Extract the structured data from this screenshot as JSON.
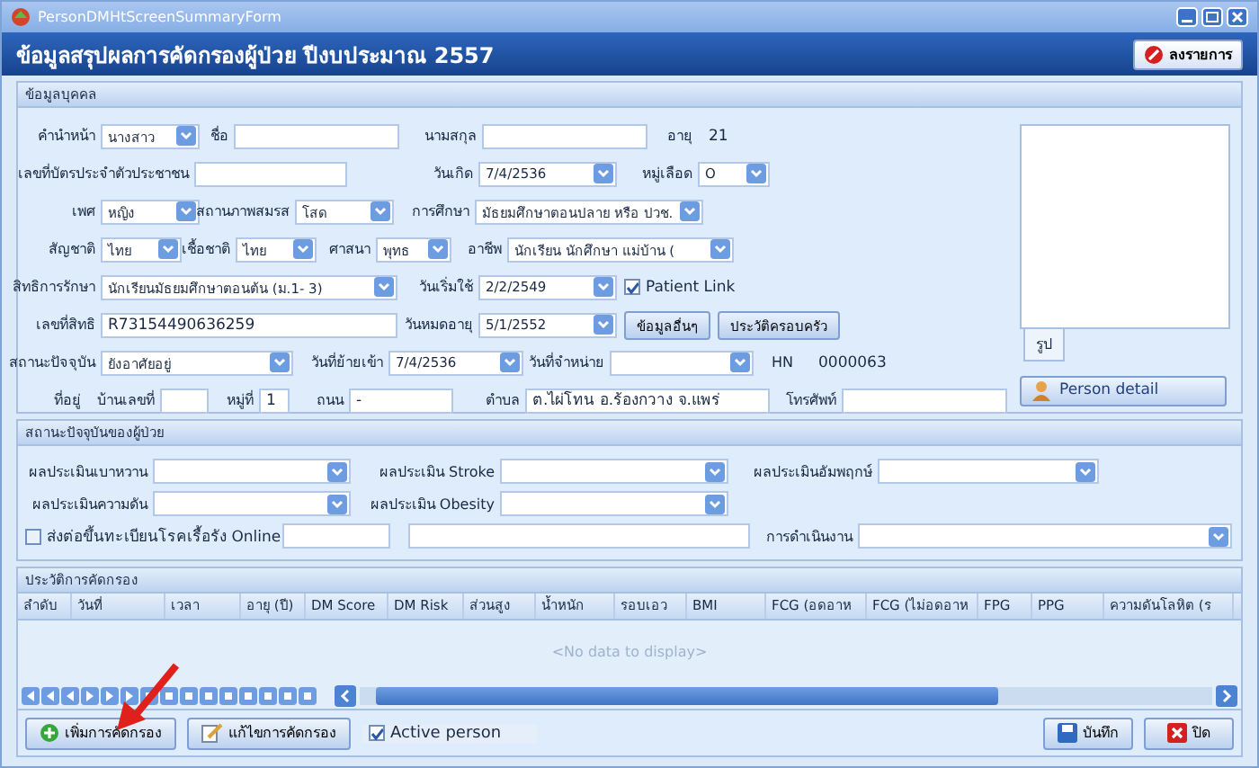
{
  "window": {
    "title": "PersonDMHtScreenSummaryForm"
  },
  "header": {
    "title": "ข้อมูลสรุปผลการคัดกรองผู้ป่วย ปีงบประมาณ 2557",
    "button": {
      "kind": "cancel",
      "label": "ลงรายการ"
    }
  },
  "person": {
    "section": "ข้อมูลบุคคล",
    "rows": [
      [
        {
          "kind": "combo",
          "label": "คำนำหน้า",
          "value": "นางสาว"
        },
        {
          "kind": "text",
          "label": "ชื่อ"
        },
        {
          "kind": "text",
          "label": "นามสกุล"
        },
        {
          "kind": "info",
          "label": "อายุ",
          "value": "21"
        }
      ],
      [
        {
          "kind": "text",
          "label": "เลขที่บัตรประจำตัวประชาชน"
        },
        {
          "kind": "combo",
          "label": "วันเกิด",
          "value": "7/4/2536"
        },
        {
          "kind": "combo",
          "label": "หมู่เลือด",
          "value": "O"
        }
      ],
      [
        {
          "kind": "combo",
          "label": "เพศ",
          "value": "หญิง"
        },
        {
          "kind": "combo",
          "label": "สถานภาพสมรส",
          "value": "โสด"
        },
        {
          "kind": "combo",
          "label": "การศึกษา",
          "value": "มัธยมศึกษาตอนปลาย หรือ ปวช."
        }
      ],
      [
        {
          "kind": "combo",
          "label": "สัญชาติ",
          "value": "ไทย"
        },
        {
          "kind": "combo",
          "label": "เชื้อชาติ",
          "value": "ไทย"
        },
        {
          "kind": "combo",
          "label": "ศาสนา",
          "value": "พุทธ"
        },
        {
          "kind": "combo",
          "label": "อาชีพ",
          "value": "นักเรียน นักศึกษา แม่บ้าน ("
        }
      ],
      [
        {
          "kind": "combo",
          "label": "สิทธิการรักษา",
          "value": "นักเรียนมัธยมศึกษาตอนต้น (ม.1- 3)"
        },
        {
          "kind": "combo",
          "label": "วันเริ่มใช้",
          "value": "2/2/2549"
        },
        {
          "kind": "check",
          "label": "Patient Link",
          "checked": true
        }
      ],
      [
        {
          "kind": "text",
          "label": "เลขที่สิทธิ",
          "value": "R73154490636259"
        },
        {
          "kind": "combo",
          "label": "วันหมดอายุ",
          "value": "5/1/2552"
        },
        {
          "kind": "button",
          "label": "ข้อมูลอื่นๆ"
        },
        {
          "kind": "button",
          "label": "ประวัติครอบครัว"
        }
      ],
      [
        {
          "kind": "combo",
          "label": "สถานะปัจจุบัน",
          "value": "ยังอาศัยอยู่"
        },
        {
          "kind": "combo",
          "label": "วันที่ย้ายเข้า",
          "value": "7/4/2536"
        },
        {
          "kind": "combo",
          "label": "วันที่จำหน่าย"
        },
        {
          "kind": "info",
          "label": "HN",
          "value": "0000063"
        }
      ]
    ],
    "address": {
      "label": "ที่อยู่",
      "fields": [
        {
          "kind": "text",
          "label": "บ้านเลขที่"
        },
        {
          "kind": "text",
          "label": "หมู่ที่",
          "value": "1"
        },
        {
          "kind": "text",
          "label": "ถนน",
          "value": "-"
        },
        {
          "kind": "text",
          "label": "ตำบล",
          "value": "ต.ไผ่โทน อ.ร้องกวาง จ.แพร่"
        },
        {
          "kind": "text",
          "label": "โทรศัพท์"
        }
      ]
    },
    "photo_tab": "รูป",
    "detail_button": "Person detail"
  },
  "status": {
    "section": "สถานะปัจจุบันของผู้ป่วย",
    "rows": [
      [
        {
          "kind": "combo",
          "label": "ผลประเมินเบาหวาน"
        },
        {
          "kind": "combo",
          "label": "ผลประเมิน Stroke"
        },
        {
          "kind": "combo",
          "label": "ผลประเมินอัมพฤกษ์"
        }
      ],
      [
        {
          "kind": "combo",
          "label": "ผลประเมินความดัน"
        },
        {
          "kind": "combo",
          "label": "ผลประเมิน Obesity"
        }
      ],
      [
        {
          "kind": "check",
          "label": "ส่งต่อขึ้นทะเบียนโรคเรื้อรัง Online",
          "checked": false
        },
        {
          "kind": "text"
        },
        {
          "kind": "text"
        },
        {
          "kind": "combo",
          "label": "การดำเนินงาน"
        }
      ]
    ]
  },
  "history": {
    "section": "ประวัติการคัดกรอง",
    "columns": [
      "ลำดับ",
      "วันที่",
      "เวลา",
      "อายุ (ปี)",
      "DM Score",
      "DM Risk",
      "ส่วนสูง",
      "น้ำหนัก",
      "รอบเอว",
      "BMI",
      "FCG (อดอาห",
      "FCG (ไม่อดอาห",
      "FPG",
      "PPG",
      "ความดันโลหิต (ร"
    ],
    "empty_text": "<No data to display>"
  },
  "actions": [
    {
      "kind": "add",
      "label": "เพิ่มการคัดกรอง"
    },
    {
      "kind": "edit",
      "label": "แก้ไขการคัดกรอง"
    },
    {
      "kind": "check",
      "label": "Active person",
      "checked": true
    },
    {
      "kind": "save",
      "label": "บันทึก"
    },
    {
      "kind": "close",
      "label": "ปิด"
    }
  ]
}
